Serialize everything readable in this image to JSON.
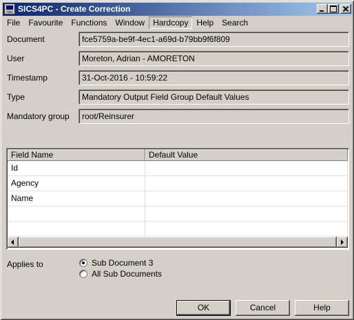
{
  "window": {
    "title": "SICS4PC - Create Correction"
  },
  "menubar": {
    "items": [
      "File",
      "Favourite",
      "Functions",
      "Window",
      "Hardcopy",
      "Help",
      "Search"
    ]
  },
  "form": {
    "document_label": "Document",
    "document_value": "fce5759a-be9f-4ec1-a69d-b79bb9f6f809",
    "user_label": "User",
    "user_value": "Moreton, Adrian - AMORETON",
    "timestamp_label": "Timestamp",
    "timestamp_value": "31-Oct-2016 - 10:59:22",
    "type_label": "Type",
    "type_value": "Mandatory Output Field Group Default Values",
    "group_label": "Mandatory group",
    "group_value": "root/Reinsurer"
  },
  "grid": {
    "columns": [
      "Field Name",
      "Default Value"
    ],
    "rows": [
      [
        "Id",
        ""
      ],
      [
        "Agency",
        ""
      ],
      [
        "Name",
        ""
      ],
      [
        "",
        ""
      ],
      [
        "",
        ""
      ]
    ]
  },
  "applies": {
    "label": "Applies to",
    "options": [
      "Sub Document 3",
      "All Sub Documents"
    ],
    "selected": 0
  },
  "buttons": {
    "ok": "OK",
    "cancel": "Cancel",
    "help": "Help"
  }
}
